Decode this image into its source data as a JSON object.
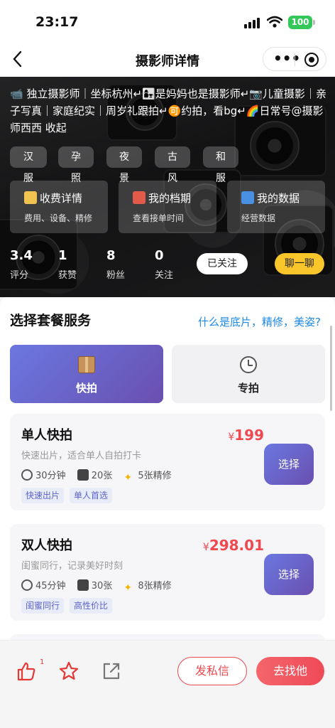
{
  "status_bar": {
    "time": "23:17",
    "battery": "100"
  },
  "nav": {
    "title": "摄影师详情",
    "back_icon": "chevron-left-icon",
    "menu_icon": "more-dots-icon",
    "close_icon": "target-icon"
  },
  "profile": {
    "bio": "📹 独立摄影师｜坐标杭州↵👩‍👧是妈妈也是摄影师↵📷儿童摄影｜亲子写真｜家庭纪实｜周岁礼跟拍↵🉑约拍，看bg↵🌈日常号@摄影师西西  收起",
    "tags": [
      "汉服",
      "孕照",
      "夜景",
      "古风",
      "和服"
    ],
    "cards": [
      {
        "title": "收费详情",
        "sub": "费用、设备、精修",
        "icon": "clipboard-icon",
        "color": "#f0c24f"
      },
      {
        "title": "我的档期",
        "sub": "查看接单时间",
        "icon": "calendar-icon",
        "color": "#e25b4a"
      },
      {
        "title": "我的数据",
        "sub": "经营数据",
        "icon": "bar-chart-icon",
        "color": "#4a90e2"
      }
    ],
    "stats": [
      {
        "value": "3.4",
        "label": "评分"
      },
      {
        "value": "1",
        "label": "获赞"
      },
      {
        "value": "8",
        "label": "粉丝"
      },
      {
        "value": "0",
        "label": "关注"
      }
    ],
    "follow_label": "已关注",
    "chat_label": "聊一聊"
  },
  "packages_section": {
    "title": "选择套餐服务",
    "help_link": "什么是底片，精修，美姿?",
    "tabs": [
      {
        "label": "快拍",
        "icon": "package-icon",
        "active": true
      },
      {
        "label": "专拍",
        "icon": "stopwatch-icon",
        "active": false
      }
    ],
    "items": [
      {
        "name": "单人快拍",
        "desc": "快速出片，适合单人自拍打卡",
        "currency": "¥",
        "price": "199",
        "duration": "30分钟",
        "photos": "20张",
        "retouch": "5张精修",
        "tags": [
          "快速出片",
          "单人首选"
        ],
        "select_label": "选择"
      },
      {
        "name": "双人快拍",
        "desc": "闺蜜同行，记录美好时刻",
        "currency": "¥",
        "price": "298.01",
        "duration": "45分钟",
        "photos": "30张",
        "retouch": "8张精修",
        "tags": [
          "闺蜜同行",
          "高性价比"
        ],
        "select_label": "选择"
      }
    ]
  },
  "bottom_bar": {
    "like_count": "1",
    "like_icon": "thumbs-up-icon",
    "star_icon": "star-icon",
    "share_icon": "share-icon",
    "message_label": "发私信",
    "find_label": "去找他",
    "accent_color": "#f0484f"
  }
}
